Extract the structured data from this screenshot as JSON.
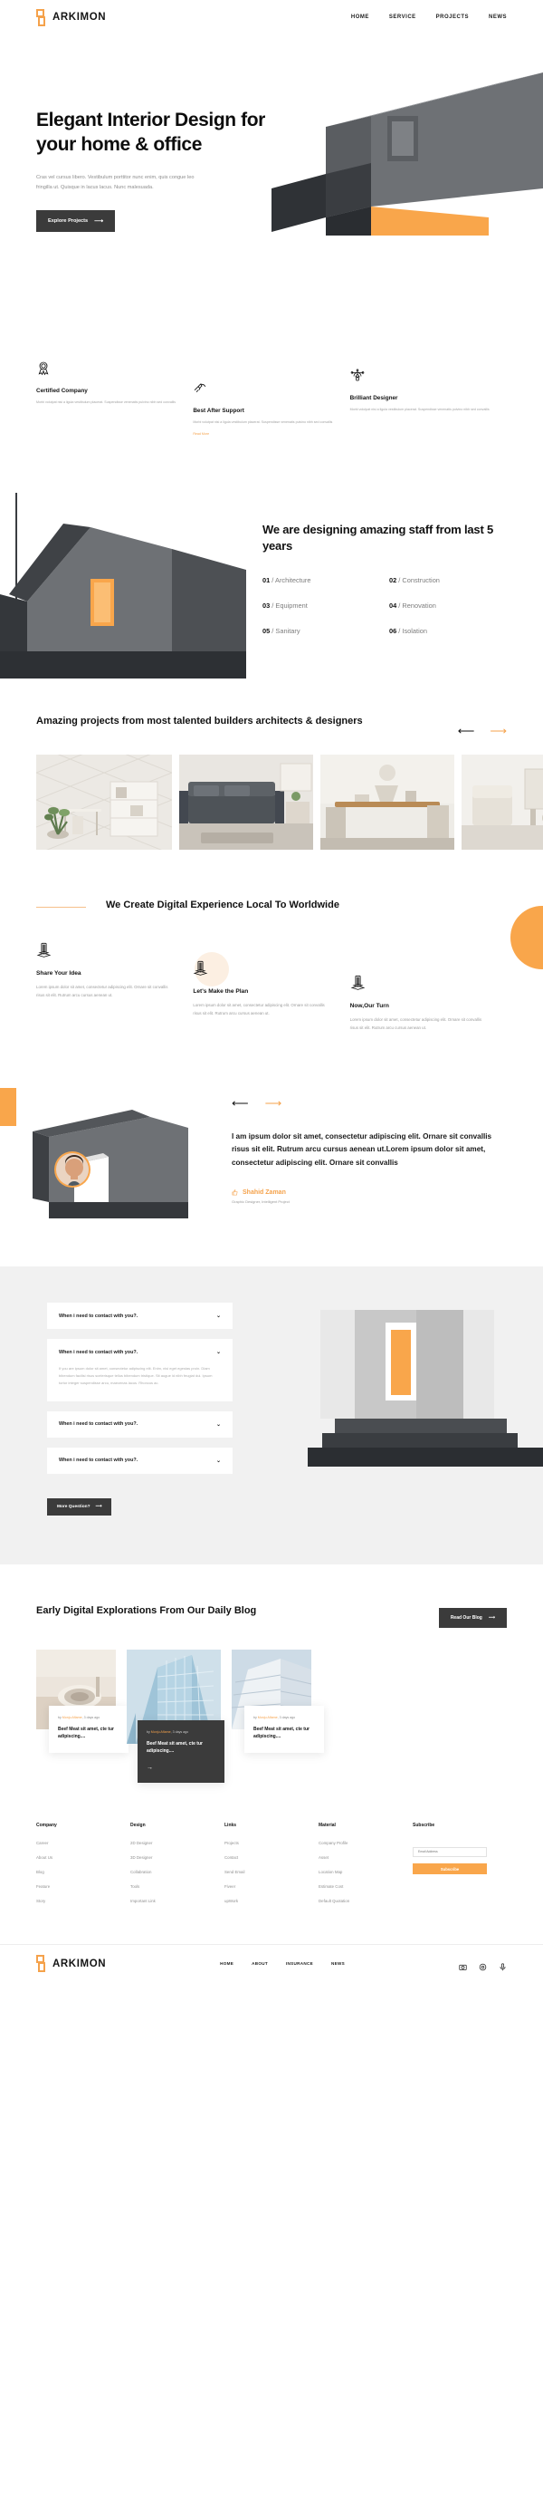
{
  "brand": {
    "name": "ARKIMON",
    "logo_icon": "arkimon-logo-icon",
    "accent": "#F5A24B"
  },
  "nav": {
    "items": [
      {
        "label": "HOME"
      },
      {
        "label": "SERVICE"
      },
      {
        "label": "PROJECTS"
      },
      {
        "label": "NEWS"
      }
    ]
  },
  "hero": {
    "title": "Elegant Interior Design for your home & office",
    "subtitle": "Cras vel cursus libero. Vestibulum porttitor nunc enim, quis congue leo fringilla ut. Quisque in lacus lacus. Nunc malesuada.",
    "cta": "Explore Projects",
    "cta_arrow": "⟶"
  },
  "features": [
    {
      "icon": "medal-ribbon-icon",
      "title": "Certified Company",
      "text": "Morbi volutpat nisi a ligula vestibulum placerat. Suspendisse venenatis pulvino nibh sed convallis",
      "more": ""
    },
    {
      "icon": "handshake-icon",
      "title": "Best After Support",
      "text": "Morbi volutpat nisi a ligula vestibulum placerat. Suspendisse venenatis pulvino nibh sed convallis",
      "more": "Read More"
    },
    {
      "icon": "compass-designer-icon",
      "title": "Brilliant Designer",
      "text": "Morbi volutpat nisi a ligula vestibulum placerat. Suspendisse venenatis pulvino nibh sed convallis",
      "more": ""
    }
  ],
  "staff": {
    "title": "We are designing amazing staff from last 5 years",
    "items": [
      {
        "num": "01",
        "sep": "/",
        "label": "Architecture"
      },
      {
        "num": "02",
        "sep": "/",
        "label": "Construction"
      },
      {
        "num": "03",
        "sep": "/",
        "label": "Equipment"
      },
      {
        "num": "04",
        "sep": "/",
        "label": "Renovation"
      },
      {
        "num": "05",
        "sep": "/",
        "label": "Sanitary"
      },
      {
        "num": "06",
        "sep": "/",
        "label": "Isolation"
      }
    ]
  },
  "projects": {
    "title": "Amazing projects from most talented builders architects & designers",
    "prev_arrow": "⟵",
    "next_arrow": "⟶",
    "cards": [
      {
        "name": "interior-plant-desk"
      },
      {
        "name": "living-room-sofa"
      },
      {
        "name": "dining-table-wood"
      },
      {
        "name": "bright-lounge"
      }
    ]
  },
  "digital": {
    "title": "We Create Digital Experience Local To Worldwide",
    "columns": [
      {
        "icon": "stack-cube-icon",
        "title": "Share Your Idea",
        "text": "Lorem ipsum dolor sit amet, consectetur adipiscing elit. Ornare sit convallis risus sit elit. Rutrum arcu cursus aenean ut."
      },
      {
        "icon": "stack-cube-icon",
        "title": "Let's Make the Plan",
        "text": "Lorem ipsum dolor sit amet, consectetur adipiscing elit. Ornare sit convallis risus sit elit. Rutrum arcu cursus aenean ut."
      },
      {
        "icon": "stack-cube-icon",
        "title": "Now,Our Turn",
        "text": "Lorem ipsum dolor sit amet, consectetur adipiscing elit. Ornare sit convallis risus sit elit. Rutrum arcu cursus aenean ut."
      }
    ]
  },
  "testimonial": {
    "prev_arrow": "⟵",
    "next_arrow": "⟶",
    "quote": "I am ipsum dolor sit amet, consectetur adipiscing elit. Ornare sit convallis risus sit elit. Rutrum arcu cursus aenean ut.Lorem ipsum dolor sit amet, consectetur adipiscing elit. Ornare sit convallis",
    "like_icon": "thumbs-up-icon",
    "name": "Shahid Zaman",
    "role": "Graphic Designer, Intelligent Project"
  },
  "faq": {
    "items": [
      {
        "question": "When i  need to contact with you?.",
        "answer": "",
        "open": false
      },
      {
        "question": "When i  need to contact with you?.",
        "answer": "If you are ipsum dolor sit amet, consectetur adipiscing elit. Enim, nisi eget egestas proin. Diam bibendum facilisi risus scelerisque tellus bibendum tristique. Sit augue id nibh feugiat dui. Ipsum tortor integer suspendisse arcu, maecenas lacus. Rhoncus ac.",
        "open": true
      },
      {
        "question": "When i  need to contact with you?.",
        "answer": "",
        "open": false
      },
      {
        "question": "When i  need to contact with you?.",
        "answer": "",
        "open": false
      }
    ],
    "button": "More Question?",
    "button_arrow": "⟶",
    "chevron_icon": "chevron-down-icon"
  },
  "blog": {
    "title": "Early Digital Explorations From Our Daily Blog",
    "button": "Read Our Blog",
    "button_arrow": "⟶",
    "cards": [
      {
        "image": "bathroom-sink-image",
        "by_prefix": "by ",
        "author": "Monju Aflame",
        "date": ", 3 days ago",
        "title": "Beef Meat sit amet, cte tur adipiscing....",
        "featured": false
      },
      {
        "image": "glass-skyscraper-image",
        "by_prefix": "by ",
        "author": "Monju Aflame",
        "date": ", 3 days ago",
        "title": "Beef Meat sit amet, cte tur adipiscing....",
        "featured": true,
        "arrow": "→"
      },
      {
        "image": "white-building-image",
        "by_prefix": "by ",
        "author": "Monju Aflame",
        "date": ", 3 days ago",
        "title": "Beef Meat sit amet, cte tur adipiscing....",
        "featured": false
      }
    ]
  },
  "footer": {
    "columns": [
      {
        "title": "Company",
        "links": [
          "Career",
          "About Us",
          "Blog",
          "Feature",
          "Story"
        ]
      },
      {
        "title": "Design",
        "links": [
          "2D Designer",
          "3D Designer",
          "Collabration",
          "Tools",
          "Important Link"
        ]
      },
      {
        "title": "Links",
        "links": [
          "Projects",
          "Contact",
          "Send Email",
          "Fiveer",
          "upWork"
        ]
      },
      {
        "title": "Material",
        "links": [
          "Company Profile",
          "Asset",
          "Location Map",
          "Estimate Cost",
          "Default Quotation"
        ]
      }
    ],
    "subscribe": {
      "title": "Subscribe",
      "placeholder": "Email Address",
      "button": "Subscribe"
    }
  },
  "bottom": {
    "brand": "ARKIMON",
    "logo_icon": "arkimon-logo-icon",
    "nav": [
      {
        "label": "HOME"
      },
      {
        "label": "ABOUT"
      },
      {
        "label": "INSURANCE"
      },
      {
        "label": "NEWS"
      }
    ],
    "social": [
      {
        "icon": "camera-icon"
      },
      {
        "icon": "circle-dot-icon"
      },
      {
        "icon": "microphone-icon"
      }
    ]
  }
}
